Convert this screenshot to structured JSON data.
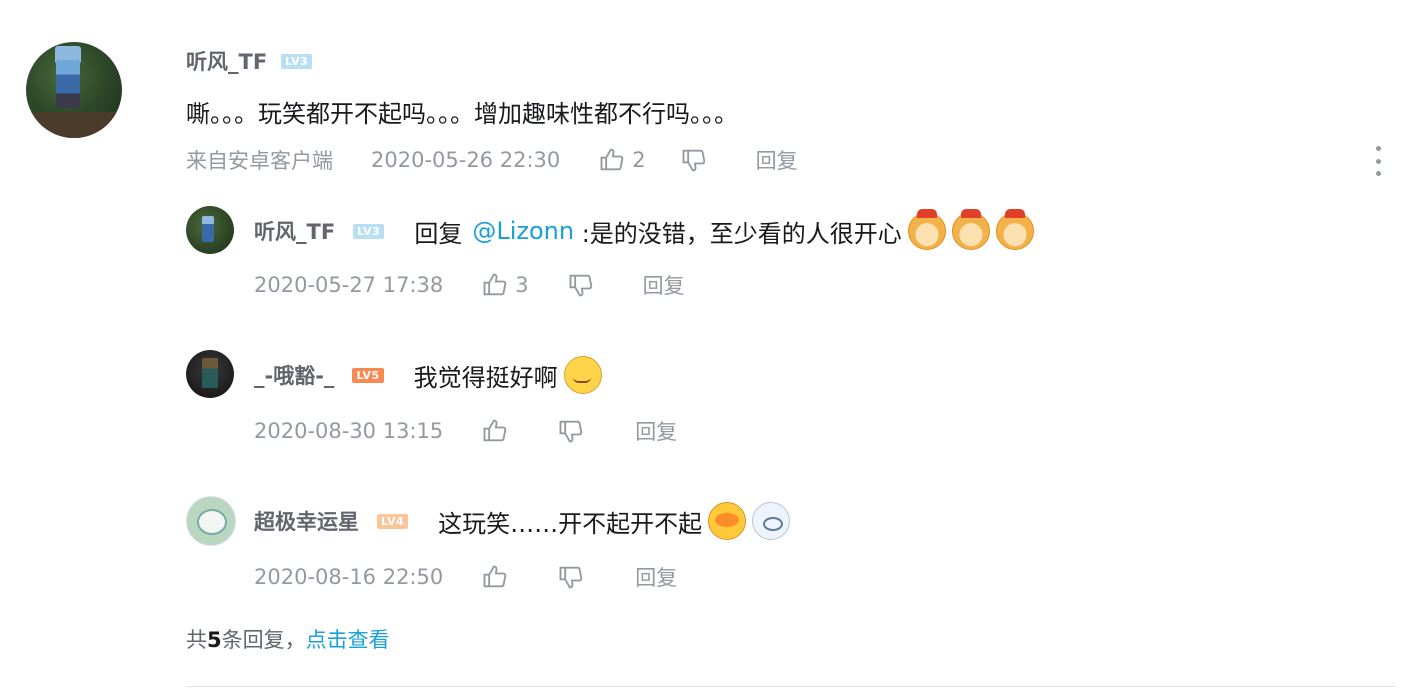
{
  "main_comment": {
    "username": "听风_TF",
    "level": "LV3",
    "text": "嘶。。。玩笑都开不起吗。。。增加趣味性都不行吗。。。",
    "source": "来自安卓客户端",
    "timestamp": "2020-05-26 22:30",
    "likes": "2",
    "reply_label": "回复"
  },
  "replies": [
    {
      "username": "听风_TF",
      "level": "LV3",
      "reply_prefix": "回复",
      "mention": "@Lizonn",
      "text": " :是的没错，至少看的人很开心",
      "emojis": [
        "doge-icon",
        "doge-icon",
        "doge-icon"
      ],
      "timestamp": "2020-05-27 17:38",
      "likes": "3",
      "reply_label": "回复"
    },
    {
      "username": "_-哦豁-_",
      "level": "LV5",
      "text": "我觉得挺好啊",
      "emojis": [
        "smirk-icon"
      ],
      "timestamp": "2020-08-30 13:15",
      "likes": "",
      "reply_label": "回复"
    },
    {
      "username": "超极幸运星",
      "level": "LV4",
      "text": "这玩笑……开不起开不起",
      "emojis": [
        "crying-icon",
        "facepalm-dog-icon"
      ],
      "timestamp": "2020-08-16 22:50",
      "likes": "",
      "reply_label": "回复"
    }
  ],
  "footer": {
    "prefix": "共",
    "count": "5",
    "suffix": "条回复，",
    "link": "点击查看"
  },
  "colors": {
    "accent": "#1aa0d8",
    "meta_gray": "#9499a0",
    "lv3": "#b9e0f2",
    "lv4": "#fbc59a",
    "lv5": "#f78a52"
  }
}
